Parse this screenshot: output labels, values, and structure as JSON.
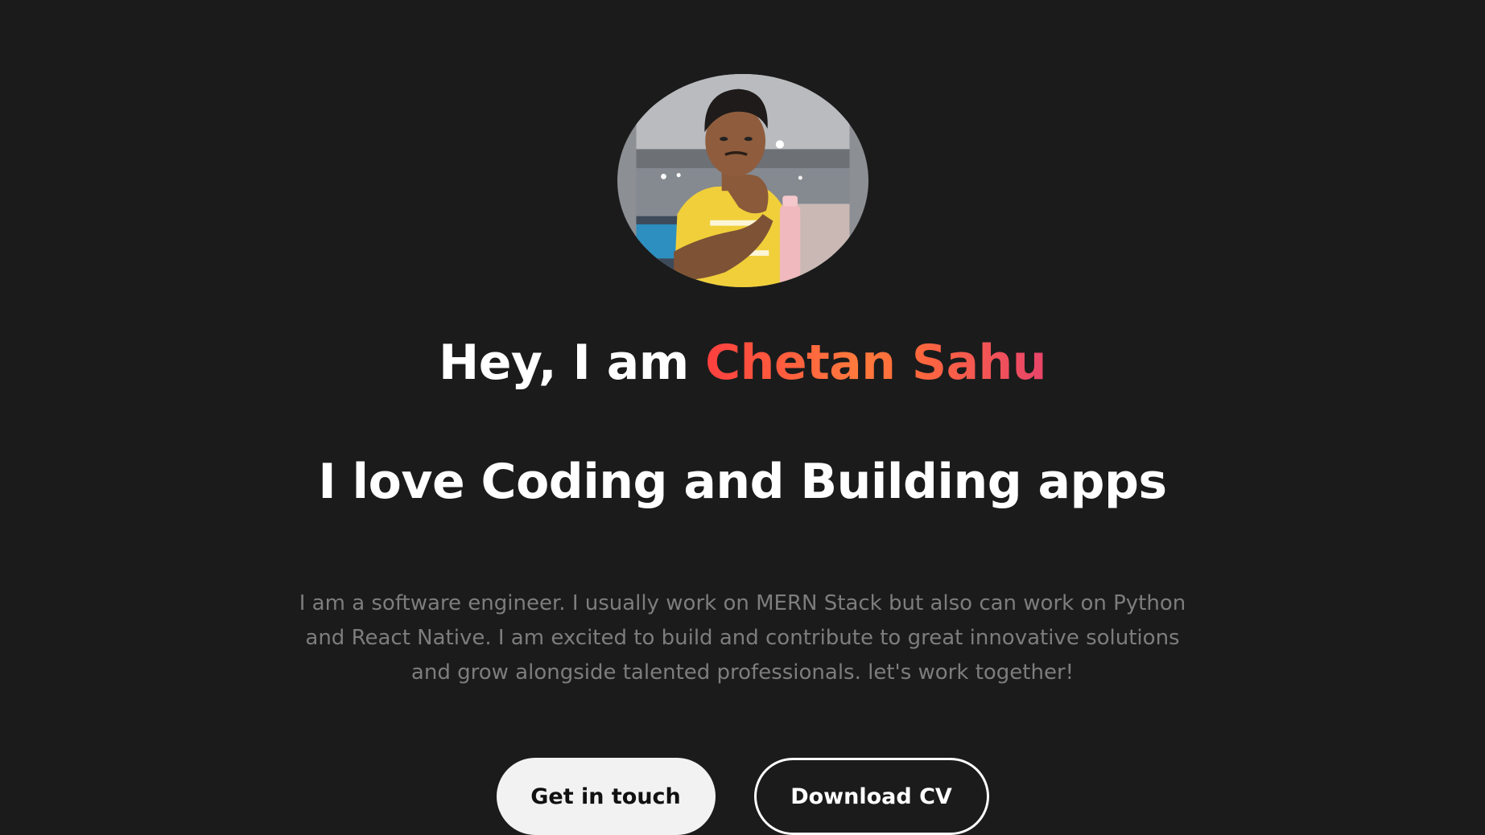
{
  "hero": {
    "greeting_prefix": "Hey, I am ",
    "name": "Chetan Sahu",
    "tagline": "I love Coding and Building apps",
    "about": "I am a software engineer. I usually work on MERN Stack but also can work on Python and React Native. I am excited to build and contribute to great innovative solutions and grow alongside talented professionals. let's work together!",
    "primary_button": "Get in touch",
    "secondary_button": "Download CV"
  },
  "colors": {
    "background": "#1b1b1b",
    "name_gradient_start": "#ff3f3f",
    "name_gradient_end": "#e8446a",
    "about_text": "#7d7d7d"
  },
  "avatar": {
    "icon": "profile-photo"
  }
}
